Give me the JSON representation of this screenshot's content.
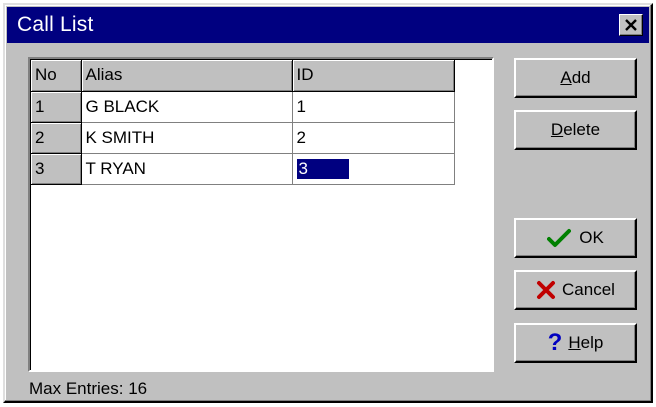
{
  "window": {
    "title": "Call List",
    "close_glyph": "✕"
  },
  "grid": {
    "headers": [
      "No",
      "Alias",
      "ID"
    ],
    "rows": [
      {
        "no": "1",
        "alias": "G  BLACK",
        "id": "1"
      },
      {
        "no": "2",
        "alias": "K SMITH",
        "id": "2"
      },
      {
        "no": "3",
        "alias": "T RYAN",
        "id": "3"
      }
    ]
  },
  "buttons": {
    "add": {
      "accel": "A",
      "rest": "dd"
    },
    "delete": {
      "accel": "D",
      "rest": "elete"
    },
    "ok": {
      "label": "OK",
      "icon": "checkmark-icon",
      "color": "#008000"
    },
    "cancel": {
      "label": "Cancel",
      "icon": "x-mark-icon",
      "color": "#c00000"
    },
    "help": {
      "accel": "H",
      "rest": "elp",
      "icon": "question-mark-icon",
      "color": "#0000c0"
    }
  },
  "footer": {
    "max_entries": "Max Entries: 16"
  }
}
